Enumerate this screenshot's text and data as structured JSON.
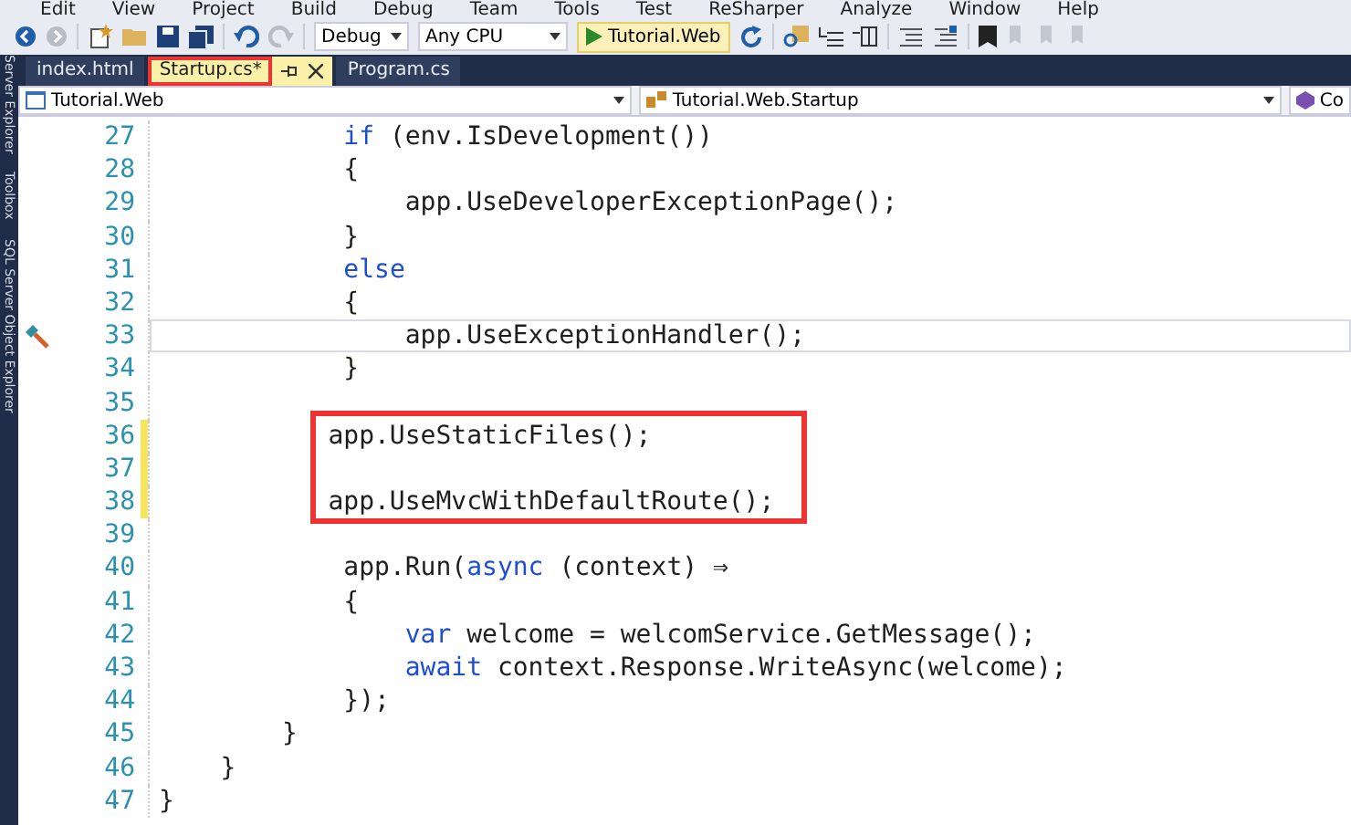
{
  "menu": [
    "Edit",
    "View",
    "Project",
    "Build",
    "Debug",
    "Team",
    "Tools",
    "Test",
    "ReSharper",
    "Analyze",
    "Window",
    "Help"
  ],
  "toolbar": {
    "configuration": "Debug",
    "platform": "Any CPU",
    "run_target": "Tutorial.Web"
  },
  "side_panel": [
    "Server Explorer",
    "Toolbox",
    "SQL Server Object Explorer"
  ],
  "tabs": [
    {
      "label": "index.html",
      "selected": false,
      "annotated": false
    },
    {
      "label": "Startup.cs*",
      "selected": true,
      "annotated": true
    },
    {
      "label": "Program.cs",
      "selected": false,
      "annotated": false
    }
  ],
  "nav_bar": {
    "project": "Tutorial.Web",
    "type": "Tutorial.Web.Startup",
    "member": "Co"
  },
  "code": [
    {
      "number": "27",
      "changed": false,
      "current": false,
      "annotated": false,
      "segments": [
        {
          "text": "            if",
          "kind": "keyword"
        },
        {
          "text": " (env.IsDevelopment())",
          "kind": "plain"
        }
      ]
    },
    {
      "number": "28",
      "changed": false,
      "current": false,
      "annotated": false,
      "segments": [
        {
          "text": "            {",
          "kind": "plain"
        }
      ]
    },
    {
      "number": "29",
      "changed": false,
      "current": false,
      "annotated": false,
      "segments": [
        {
          "text": "                app.UseDeveloperExceptionPage();",
          "kind": "plain"
        }
      ]
    },
    {
      "number": "30",
      "changed": false,
      "current": false,
      "annotated": false,
      "segments": [
        {
          "text": "            }",
          "kind": "plain"
        }
      ]
    },
    {
      "number": "31",
      "changed": false,
      "current": false,
      "annotated": false,
      "segments": [
        {
          "text": "            else",
          "kind": "keyword"
        }
      ]
    },
    {
      "number": "32",
      "changed": false,
      "current": false,
      "annotated": false,
      "segments": [
        {
          "text": "            {",
          "kind": "plain"
        }
      ]
    },
    {
      "number": "33",
      "changed": false,
      "current": true,
      "annotated": false,
      "segments": [
        {
          "text": "                app.UseExceptionHandler();",
          "kind": "plain"
        }
      ]
    },
    {
      "number": "34",
      "changed": false,
      "current": false,
      "annotated": false,
      "segments": [
        {
          "text": "            }",
          "kind": "plain"
        }
      ]
    },
    {
      "number": "35",
      "changed": false,
      "current": false,
      "annotated": false
    },
    {
      "number": "36",
      "changed": true,
      "current": false,
      "annotated": true,
      "segments": [
        {
          "text": "           app.UseStaticFiles();",
          "kind": "plain"
        }
      ]
    },
    {
      "number": "37",
      "changed": true,
      "current": false,
      "annotated": true
    },
    {
      "number": "38",
      "changed": true,
      "current": false,
      "annotated": true,
      "segments": [
        {
          "text": "           app.UseMvcWithDefaultRoute();",
          "kind": "plain"
        }
      ]
    },
    {
      "number": "39",
      "changed": false,
      "current": false,
      "annotated": false
    },
    {
      "number": "40",
      "changed": false,
      "current": false,
      "annotated": false,
      "segments": [
        {
          "text": "            app.Run(",
          "kind": "plain"
        },
        {
          "text": "async",
          "kind": "keyword"
        },
        {
          "text": " (context) ⇒",
          "kind": "plain"
        }
      ]
    },
    {
      "number": "41",
      "changed": false,
      "current": false,
      "annotated": false,
      "segments": [
        {
          "text": "            {",
          "kind": "plain"
        }
      ]
    },
    {
      "number": "42",
      "changed": false,
      "current": false,
      "annotated": false,
      "segments": [
        {
          "text": "                var",
          "kind": "keyword"
        },
        {
          "text": " welcome = welcomService.GetMessage();",
          "kind": "plain"
        }
      ]
    },
    {
      "number": "43",
      "changed": false,
      "current": false,
      "annotated": false,
      "segments": [
        {
          "text": "                await",
          "kind": "keyword"
        },
        {
          "text": " context.Response.WriteAsync(welcome);",
          "kind": "plain"
        }
      ]
    },
    {
      "number": "44",
      "changed": false,
      "current": false,
      "annotated": false,
      "segments": [
        {
          "text": "            });",
          "kind": "plain"
        }
      ]
    },
    {
      "number": "45",
      "changed": false,
      "current": false,
      "annotated": false,
      "segments": [
        {
          "text": "        }",
          "kind": "plain"
        }
      ]
    },
    {
      "number": "46",
      "changed": false,
      "current": false,
      "annotated": false,
      "segments": [
        {
          "text": "    }",
          "kind": "plain"
        }
      ]
    },
    {
      "number": "47",
      "changed": false,
      "current": false,
      "annotated": false,
      "segments": [
        {
          "text": "}",
          "kind": "plain"
        }
      ]
    }
  ]
}
